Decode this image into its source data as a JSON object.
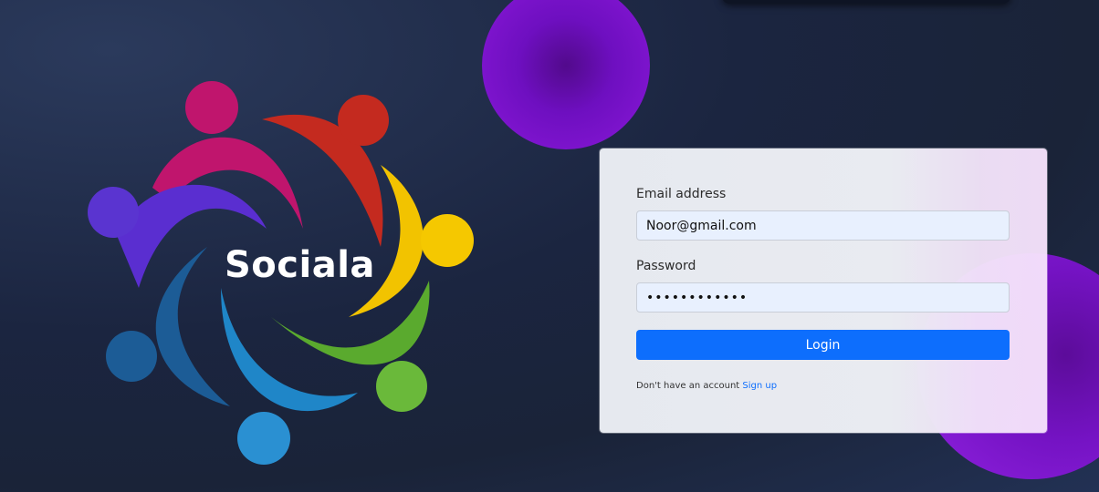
{
  "brand": {
    "name": "Sociala",
    "logo_icon": "people-circle-logo"
  },
  "login_form": {
    "email_label": "Email address",
    "email_value": "Noor@gmail.com",
    "password_label": "Password",
    "password_value": "••••••••••••",
    "login_label": "Login",
    "signup_prompt": "Don't have an account",
    "signup_link": "Sign up"
  },
  "colors": {
    "primary": "#0d6efd",
    "blob_purple": "#7a14c8",
    "background": "#1b2540"
  }
}
